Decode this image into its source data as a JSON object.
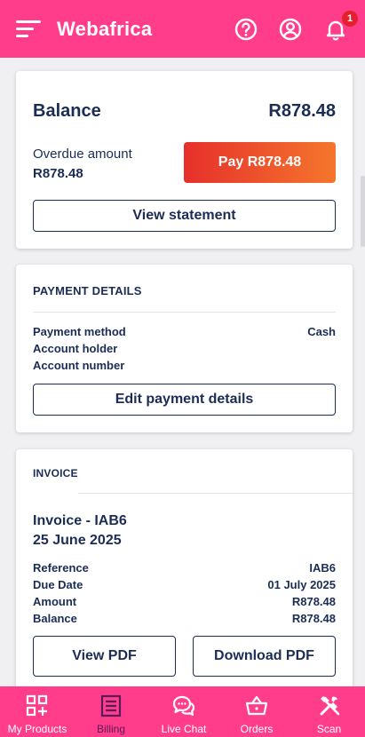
{
  "header": {
    "logo": "Webafrica",
    "notification_count": "1"
  },
  "balance": {
    "title": "Balance",
    "amount": "R878.48",
    "overdue_label": "Overdue amount",
    "overdue_amount": "R878.48",
    "pay_label": "Pay R878.48",
    "statement_label": "View statement"
  },
  "payment": {
    "heading": "PAYMENT DETAILS",
    "rows": [
      {
        "label": "Payment method",
        "value": "Cash"
      },
      {
        "label": "Account holder",
        "value": ""
      },
      {
        "label": "Account number",
        "value": ""
      }
    ],
    "edit_label": "Edit payment details"
  },
  "invoice": {
    "heading": "INVOICE",
    "title": "Invoice - IAB6",
    "date": "25 June 2025",
    "rows": [
      {
        "label": "Reference",
        "value": "IAB6"
      },
      {
        "label": "Due Date",
        "value": "01 July 2025"
      },
      {
        "label": "Amount",
        "value": "R878.48"
      },
      {
        "label": "Balance",
        "value": "R878.48"
      }
    ],
    "view_pdf_label": "View PDF",
    "download_pdf_label": "Download PDF"
  },
  "bottom_nav": [
    {
      "label": "My Products",
      "icon": "grid-plus-icon"
    },
    {
      "label": "Billing",
      "icon": "billing-icon",
      "active": true
    },
    {
      "label": "Live Chat",
      "icon": "chat-icon"
    },
    {
      "label": "Orders",
      "icon": "basket-icon"
    },
    {
      "label": "Scan",
      "icon": "tools-icon"
    }
  ],
  "colors": {
    "brand_pink": "#ff3d8b",
    "navy": "#1b2d55",
    "pay_gradient_start": "#e6302b",
    "pay_gradient_end": "#f5762c",
    "active_nav": "#5b1a5a"
  }
}
